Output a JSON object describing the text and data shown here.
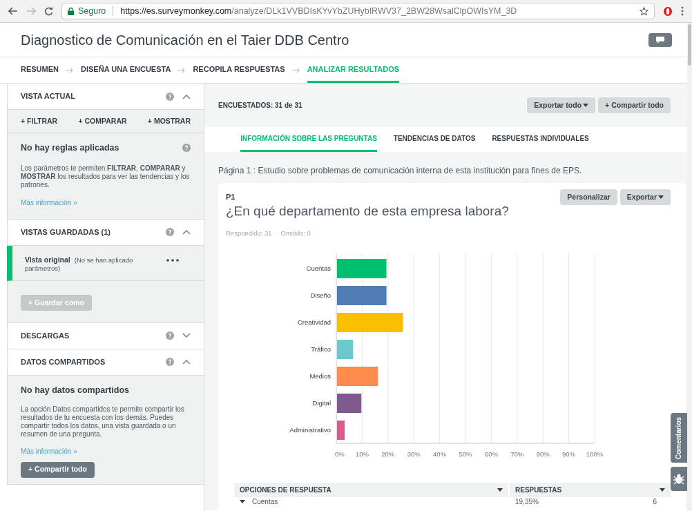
{
  "browser": {
    "secure_label": "Seguro",
    "url_host": "https://es.surveymonkey.com",
    "url_path": "/analyze/DLk1VVBDIsKYvYbZUHybIRWV37_2BW28WsalClpOWIsYM_3D"
  },
  "header": {
    "title": "Diagnostico de Comunicación en el Taier DDB Centro"
  },
  "steps": [
    {
      "label": "RESUMEN",
      "selected": false
    },
    {
      "label": "DISEÑA UNA ENCUESTA",
      "selected": false
    },
    {
      "label": "RECOPILA RESPUESTAS",
      "selected": false
    },
    {
      "label": "ANALIZAR RESULTADOS",
      "selected": true
    }
  ],
  "sidebar": {
    "current_view": {
      "title": "VISTA ACTUAL",
      "expanded": true,
      "actions": [
        "+ FILTRAR",
        "+ COMPARAR",
        "+ MOSTRAR"
      ],
      "rules_title": "No hay reglas aplicadas",
      "rules_text": "Los parámetros te permiten **FILTRAR**, **COMPARAR** y **MOSTRAR** los resultados para ver las tendencias y los patrones.",
      "more_link": "Más información »"
    },
    "saved_views": {
      "title": "VISTAS GUARDADAS (1)",
      "expanded": true,
      "views": [
        {
          "name": "Vista original",
          "note": "(No se han aplicado parámetros)",
          "selected": true
        }
      ],
      "save_button": {
        "label": "+ Guardar como",
        "disabled": true
      }
    },
    "downloads": {
      "title": "DESCARGAS",
      "expanded": false
    },
    "shared_data": {
      "title": "DATOS COMPARTIDOS",
      "expanded": true,
      "empty_title": "No hay datos compartidos",
      "text": "La opción Datos compartidos te permite compartir los resultados de tu encuesta con los demás. Puedes compartir todos los datos, una vista guardada o un resumen de una pregunta.",
      "more_link": "Más información »",
      "share_button": "+ Compartir todo"
    }
  },
  "main": {
    "respondents": "ENCUESTADOS: 31 de 31",
    "export_all": "Exportar todo",
    "share_all": "+ Compartir todo",
    "tabs": [
      {
        "label": "INFORMACIÓN SOBRE LAS PREGUNTAS",
        "selected": true
      },
      {
        "label": "TENDENCIAS DE DATOS",
        "selected": false
      },
      {
        "label": "RESPUESTAS INDIVIDUALES",
        "selected": false
      }
    ],
    "page_title": "Página 1 : Estudio sobre problemas de comunicación interna de esta institución para fines de EPS.",
    "question": {
      "number": "P1",
      "title": "¿En qué departamento de esta empresa labora?",
      "customize": "Personalizar",
      "export": "Exportar",
      "answered": "Respondido: 31",
      "skipped": "Omitido: 0",
      "chart_data": {
        "type": "bar",
        "orientation": "horizontal",
        "categories": [
          "Cuentas",
          "Diseño",
          "Creatividad",
          "Tráfico",
          "Medios",
          "Digital",
          "Administrativo"
        ],
        "series": [
          {
            "values": [
              19.4,
              19.4,
              25.8,
              6.5,
              16.1,
              9.7,
              3.2
            ]
          }
        ],
        "grid": true,
        "colors": [
          "#00bf6f",
          "#507cb6",
          "#f9be00",
          "#6bc8cd",
          "#ff8b4f",
          "#7f5a8e",
          "#d25f90"
        ],
        "xlim": [
          0,
          100
        ],
        "xticks": [
          {
            "value": 0,
            "label": "0%"
          },
          {
            "value": 10,
            "label": "10%"
          },
          {
            "value": 20,
            "label": "20%"
          },
          {
            "value": 30,
            "label": "30%"
          },
          {
            "value": 40,
            "label": "40%"
          },
          {
            "value": 50,
            "label": "50%"
          },
          {
            "value": 60,
            "label": "60%"
          },
          {
            "value": 70,
            "label": "70%"
          },
          {
            "value": 80,
            "label": "80%"
          },
          {
            "value": 90,
            "label": "90%"
          },
          {
            "value": 100,
            "label": "100%"
          }
        ]
      },
      "table": {
        "columns": [
          "OPCIONES DE RESPUESTA",
          "RESPUESTAS"
        ],
        "rows": [
          {
            "option": "Cuentas",
            "percent": "19,35%",
            "count": "6",
            "expanded": true
          }
        ]
      }
    },
    "side_tab": "Comentarios"
  }
}
